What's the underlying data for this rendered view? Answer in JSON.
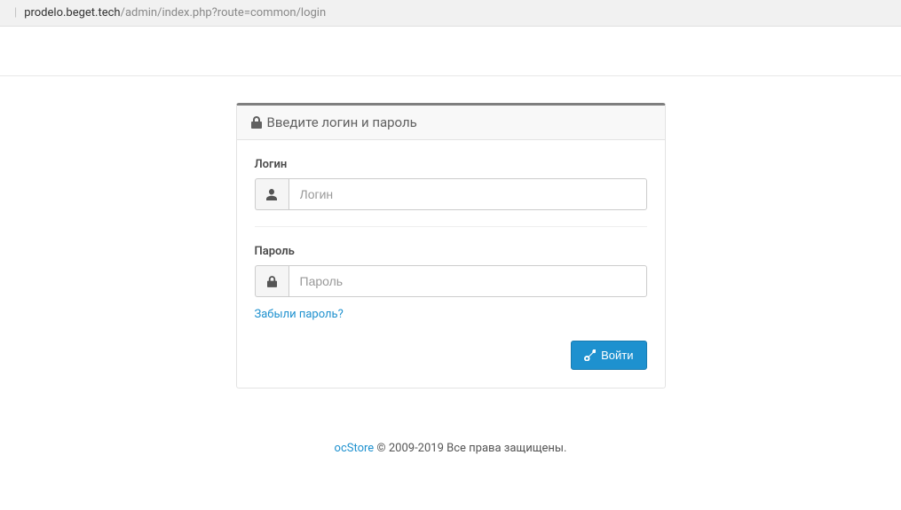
{
  "url": {
    "domain": "prodelo.beget.tech",
    "path": "/admin/index.php?route=common/login"
  },
  "panel": {
    "title": "Введите логин и пароль"
  },
  "form": {
    "username_label": "Логин",
    "username_placeholder": "Логин",
    "password_label": "Пароль",
    "password_placeholder": "Пароль",
    "forgot_label": "Забыли пароль?",
    "submit_label": "Войти"
  },
  "footer": {
    "link_text": "ocStore",
    "copyright": " © 2009-2019 Все права защищены."
  }
}
